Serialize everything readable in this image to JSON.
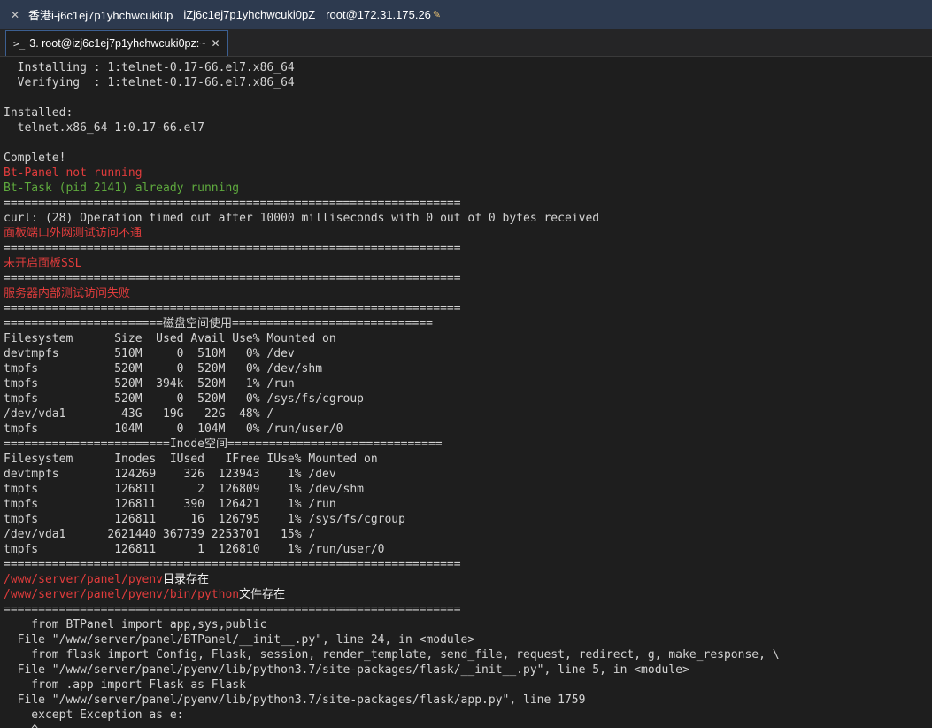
{
  "window": {
    "items": [
      "香港i-j6c1ej7p1yhchwcuki0p",
      "iZj6c1ej7p1yhchwcuki0pZ",
      "root@172.31.175.26"
    ]
  },
  "tab": {
    "label": "3. root@izj6c1ej7p1yhchwcuki0pz:~"
  },
  "colors": {
    "red": "#e03c3c",
    "green": "#5faa3e",
    "default": "#d4d4d4",
    "background": "#1e1e1e"
  },
  "terminal": {
    "lines": [
      [
        {
          "t": "  Installing : 1:telnet-0.17-66.el7.x86_64"
        }
      ],
      [
        {
          "t": "  Verifying  : 1:telnet-0.17-66.el7.x86_64"
        }
      ],
      [
        {
          "t": ""
        }
      ],
      [
        {
          "t": "Installed:"
        }
      ],
      [
        {
          "t": "  telnet.x86_64 1:0.17-66.el7"
        }
      ],
      [
        {
          "t": ""
        }
      ],
      [
        {
          "t": "Complete!"
        }
      ],
      [
        {
          "t": "Bt-Panel not running",
          "c": "red"
        }
      ],
      [
        {
          "t": "Bt-Task (pid 2141) already running",
          "c": "green"
        }
      ],
      [
        {
          "t": "=================================================================="
        }
      ],
      [
        {
          "t": "curl: (28) Operation timed out after 10000 milliseconds with 0 out of 0 bytes received"
        }
      ],
      [
        {
          "t": "面板端口外网测试访问不通",
          "c": "red"
        }
      ],
      [
        {
          "t": "=================================================================="
        }
      ],
      [
        {
          "t": "未开启面板SSL",
          "c": "red"
        }
      ],
      [
        {
          "t": "=================================================================="
        }
      ],
      [
        {
          "t": "服务器内部测试访问失败",
          "c": "red"
        }
      ],
      [
        {
          "t": "=================================================================="
        }
      ],
      [
        {
          "t": "=======================磁盘空间使用============================="
        }
      ],
      [
        {
          "t": "Filesystem      Size  Used Avail Use% Mounted on"
        }
      ],
      [
        {
          "t": "devtmpfs        510M     0  510M   0% /dev"
        }
      ],
      [
        {
          "t": "tmpfs           520M     0  520M   0% /dev/shm"
        }
      ],
      [
        {
          "t": "tmpfs           520M  394k  520M   1% /run"
        }
      ],
      [
        {
          "t": "tmpfs           520M     0  520M   0% /sys/fs/cgroup"
        }
      ],
      [
        {
          "t": "/dev/vda1        43G   19G   22G  48% /"
        }
      ],
      [
        {
          "t": "tmpfs           104M     0  104M   0% /run/user/0"
        }
      ],
      [
        {
          "t": "========================Inode空间==============================="
        }
      ],
      [
        {
          "t": "Filesystem      Inodes  IUsed   IFree IUse% Mounted on"
        }
      ],
      [
        {
          "t": "devtmpfs        124269    326  123943    1% /dev"
        }
      ],
      [
        {
          "t": "tmpfs           126811      2  126809    1% /dev/shm"
        }
      ],
      [
        {
          "t": "tmpfs           126811    390  126421    1% /run"
        }
      ],
      [
        {
          "t": "tmpfs           126811     16  126795    1% /sys/fs/cgroup"
        }
      ],
      [
        {
          "t": "/dev/vda1      2621440 367739 2253701   15% /"
        }
      ],
      [
        {
          "t": "tmpfs           126811      1  126810    1% /run/user/0"
        }
      ],
      [
        {
          "t": "=================================================================="
        }
      ],
      [
        {
          "t": "/www/server/panel/pyenv",
          "c": "red"
        },
        {
          "t": "目录存在",
          "c": "white"
        }
      ],
      [
        {
          "t": "/www/server/panel/pyenv/bin/python",
          "c": "red"
        },
        {
          "t": "文件存在",
          "c": "white"
        }
      ],
      [
        {
          "t": "=================================================================="
        }
      ],
      [
        {
          "t": "    from BTPanel import app,sys,public"
        }
      ],
      [
        {
          "t": "  File \"/www/server/panel/BTPanel/__init__.py\", line 24, in <module>"
        }
      ],
      [
        {
          "t": "    from flask import Config, Flask, session, render_template, send_file, request, redirect, g, make_response, \\"
        }
      ],
      [
        {
          "t": "  File \"/www/server/panel/pyenv/lib/python3.7/site-packages/flask/__init__.py\", line 5, in <module>"
        }
      ],
      [
        {
          "t": "    from .app import Flask as Flask"
        }
      ],
      [
        {
          "t": "  File \"/www/server/panel/pyenv/lib/python3.7/site-packages/flask/app.py\", line 1759"
        }
      ],
      [
        {
          "t": "    except Exception as e:"
        }
      ],
      [
        {
          "t": "    ^"
        }
      ]
    ]
  }
}
